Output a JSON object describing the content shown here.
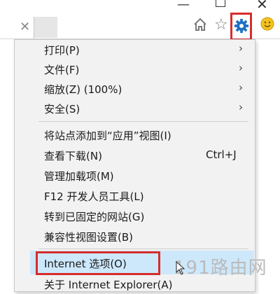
{
  "window": {
    "minimize": "—",
    "close": "✕"
  },
  "tab": {
    "close": "✕"
  },
  "toolbar": {
    "star": "☆"
  },
  "menu": {
    "items": [
      {
        "label": "打印(P)",
        "arrow": "›"
      },
      {
        "label": "文件(F)",
        "arrow": "›"
      },
      {
        "label": "缩放(Z) (100%)",
        "arrow": "›"
      },
      {
        "label": "安全(S)",
        "arrow": "›"
      },
      {
        "label": "将站点添加到“应用”视图(I)"
      },
      {
        "label": "查看下载(N)",
        "shortcut": "Ctrl+J"
      },
      {
        "label": "管理加载项(M)"
      },
      {
        "label": "F12 开发人员工具(L)"
      },
      {
        "label": "转到已固定的网站(G)"
      },
      {
        "label": "兼容性视图设置(B)"
      },
      {
        "label": "Internet 选项(O)"
      },
      {
        "label": "关于 Internet Explorer(A)"
      }
    ]
  },
  "watermark": "191路由网",
  "colors": {
    "highlight": "#cde8fb",
    "annotation": "#d62d2d",
    "gear": "#1e6fc4",
    "smile": "#f3c221"
  }
}
